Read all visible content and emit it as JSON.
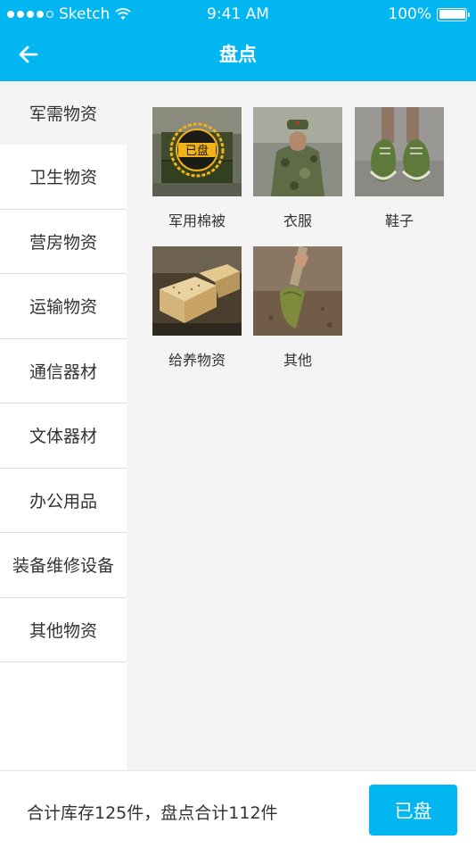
{
  "status_bar": {
    "carrier": "Sketch",
    "time": "9:41 AM",
    "battery": "100%"
  },
  "nav": {
    "title": "盘点",
    "back_icon": "arrow-left-icon"
  },
  "sidebar": {
    "items": [
      {
        "label": "军需物资",
        "active": true
      },
      {
        "label": "卫生物资",
        "active": false
      },
      {
        "label": "营房物资",
        "active": false
      },
      {
        "label": "运输物资",
        "active": false
      },
      {
        "label": "通信器材",
        "active": false
      },
      {
        "label": "文体器材",
        "active": false
      },
      {
        "label": "办公用品",
        "active": false
      },
      {
        "label": "装备维修设备",
        "active": false
      },
      {
        "label": "其他物资",
        "active": false
      }
    ]
  },
  "grid": {
    "items": [
      {
        "label": "军用棉被",
        "badge": "已盘"
      },
      {
        "label": "衣服"
      },
      {
        "label": "鞋子"
      },
      {
        "label": "给养物资"
      },
      {
        "label": "其他"
      }
    ]
  },
  "footer": {
    "summary": "合计库存125件，盘点合计112件",
    "button_label": "已盘"
  },
  "colors": {
    "primary": "#02b6f1",
    "badge": "#f2b21a"
  }
}
